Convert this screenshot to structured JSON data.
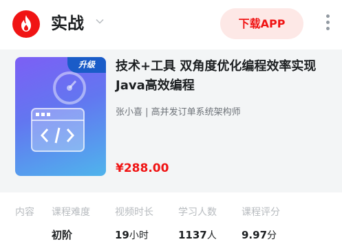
{
  "header": {
    "title": "实战",
    "download_label": "下载APP"
  },
  "course": {
    "badge": "升级",
    "title": "技术+工具 双角度优化编程效率实现Java高效编程",
    "author": "张小喜 | 高并发订单系统架构师",
    "price": "¥288.00"
  },
  "stats": {
    "section_label": "内容",
    "labels": [
      "课程难度",
      "视频时长",
      "学习人数",
      "课程评分"
    ],
    "values": [
      {
        "main": "初阶",
        "unit": ""
      },
      {
        "main": "19",
        "unit": "小时"
      },
      {
        "main": "1137",
        "unit": "人"
      },
      {
        "main": "9.97",
        "unit": "分"
      }
    ]
  },
  "colors": {
    "brand_red": "#f01414",
    "download_bg": "#fde8e6",
    "cover_gradient_start": "#7c5ff5",
    "cover_gradient_end": "#4fb4ec",
    "badge_blue": "#1a5cc8"
  },
  "icons": [
    "flame-logo-icon",
    "chevron-down-icon",
    "more-vertical-icon",
    "speedometer-icon",
    "code-window-icon"
  ]
}
